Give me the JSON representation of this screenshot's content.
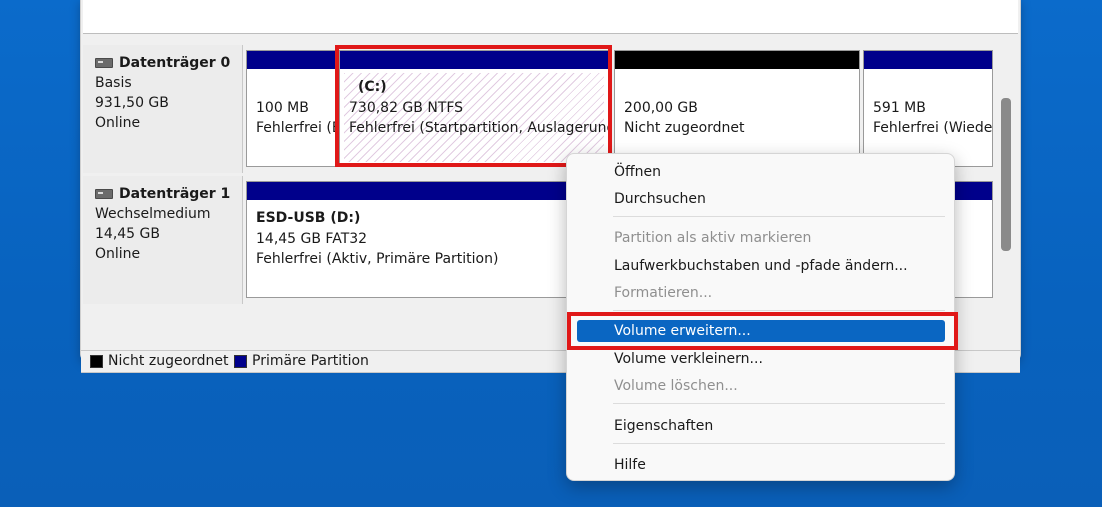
{
  "disks": [
    {
      "title": "Datenträger 0",
      "type": "Basis",
      "size": "931,50 GB",
      "status": "Online",
      "partitions": [
        {
          "name": "",
          "size": "100 MB",
          "status": "Fehlerfrei (E",
          "bar": "blue"
        },
        {
          "name": "(C:)",
          "size": "730,82 GB NTFS",
          "status": "Fehlerfrei (Startpartition, Auslagerungs",
          "bar": "blue"
        },
        {
          "name": "",
          "size": "200,00 GB",
          "status": "Nicht zugeordnet",
          "bar": "black"
        },
        {
          "name": "",
          "size": "591 MB",
          "status": "Fehlerfrei (Wiede",
          "bar": "blue"
        }
      ]
    },
    {
      "title": "Datenträger 1",
      "type": "Wechselmedium",
      "size": "14,45 GB",
      "status": "Online",
      "partitions": [
        {
          "name": "ESD-USB  (D:)",
          "size": "14,45 GB FAT32",
          "status": "Fehlerfrei (Aktiv, Primäre Partition)",
          "bar": "blue"
        }
      ]
    }
  ],
  "legend": [
    {
      "label": "Nicht zugeordnet",
      "color": "#000000"
    },
    {
      "label": "Primäre Partition",
      "color": "#00008b"
    }
  ],
  "context_menu": {
    "items": [
      {
        "label": "Öffnen",
        "enabled": true
      },
      {
        "label": "Durchsuchen",
        "enabled": true
      },
      {
        "label": "Partition als aktiv markieren",
        "enabled": false
      },
      {
        "label": "Laufwerkbuchstaben und -pfade ändern...",
        "enabled": true
      },
      {
        "label": "Formatieren...",
        "enabled": false
      },
      {
        "label": "Volume erweitern...",
        "enabled": true,
        "selected": true
      },
      {
        "label": "Volume verkleinern...",
        "enabled": true
      },
      {
        "label": "Volume löschen...",
        "enabled": false
      },
      {
        "label": "Eigenschaften",
        "enabled": true
      },
      {
        "label": "Hilfe",
        "enabled": true
      }
    ]
  },
  "colors": {
    "desktop": "#0a66c2",
    "primary_partition": "#00008b",
    "unallocated": "#000000",
    "highlight": "#e01818",
    "menu_selection": "#0a66c2"
  }
}
